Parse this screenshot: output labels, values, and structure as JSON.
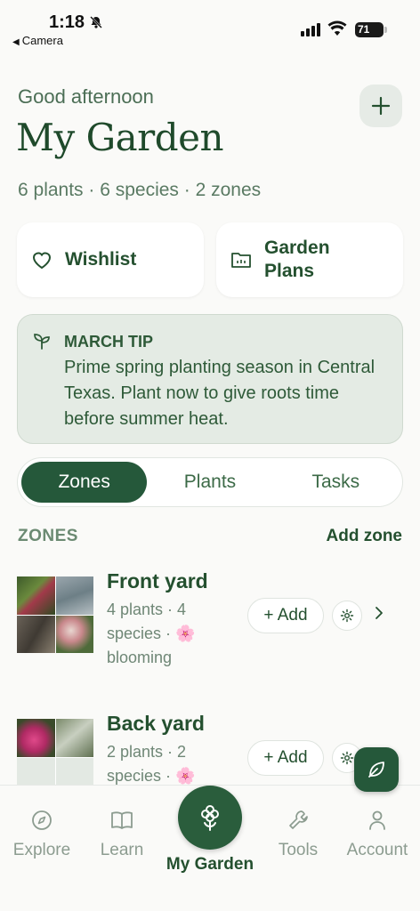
{
  "status_bar": {
    "time": "1:18",
    "back_label": "Camera",
    "battery": "71"
  },
  "header": {
    "greeting": "Good afternoon",
    "title": "My Garden",
    "summary": "6 plants · 6 species · 2 zones"
  },
  "quick_links": [
    {
      "label": "Wishlist",
      "icon": "heart-icon"
    },
    {
      "label": "Garden\nPlans",
      "icon": "folder-icon"
    }
  ],
  "tip": {
    "title": "MARCH TIP",
    "text": "Prime spring planting season in Central Texas. Plant now to give roots time before summer heat."
  },
  "segments": {
    "active": "Zones",
    "items": [
      "Zones",
      "Plants",
      "Tasks"
    ]
  },
  "zones_section": {
    "header": "ZONES",
    "add_label": "Add zone"
  },
  "zones": [
    {
      "name": "Front yard",
      "meta": "4 plants · 4 species · 🌸 blooming",
      "add_label": "+ Add"
    },
    {
      "name": "Back yard",
      "meta": "2 plants · 2 species · 🌸",
      "add_label": "+ Add"
    }
  ],
  "nav": [
    {
      "label": "Explore",
      "icon": "compass-icon"
    },
    {
      "label": "Learn",
      "icon": "book-icon"
    },
    {
      "label": "My Garden",
      "icon": "flower-icon",
      "active": true
    },
    {
      "label": "Tools",
      "icon": "wrench-icon"
    },
    {
      "label": "Account",
      "icon": "user-icon"
    }
  ],
  "colors": {
    "primary": "#25583a",
    "background": "#fafaf8",
    "tip_background": "#e4ebe4"
  }
}
